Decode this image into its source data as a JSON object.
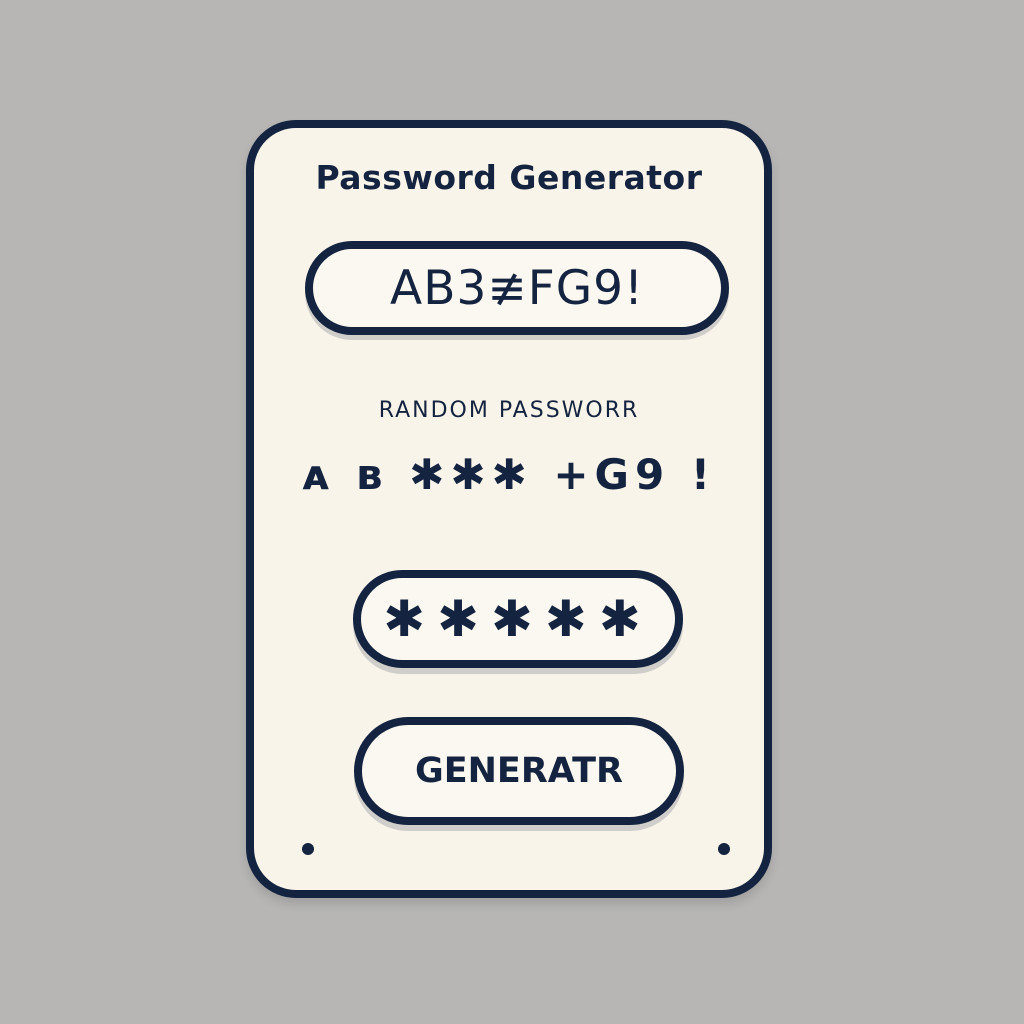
{
  "panel": {
    "title": "Password Generator",
    "generated_password": "AB3≢FG9!",
    "label": "RANDOM PASSWORR",
    "masked_preview": "ᴀ ʙ ✱✱✱ +G9 !",
    "mask_field_value": "✱✱✱✱✱",
    "generate_button_label": "GENERATR"
  },
  "colors": {
    "background": "#b7b6b5",
    "panel": "#f9f4ea",
    "ink": "#14233f"
  }
}
